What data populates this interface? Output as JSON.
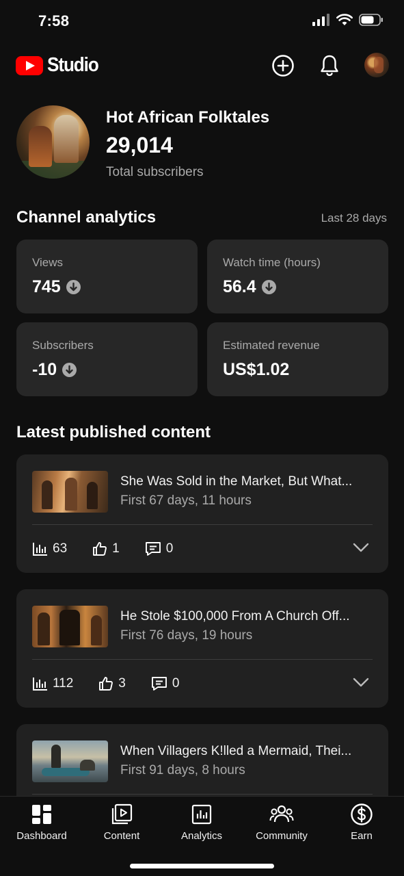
{
  "status_bar": {
    "time": "7:58"
  },
  "header": {
    "brand": "Studio"
  },
  "channel": {
    "name": "Hot African Folktales",
    "subscribers": "29,014",
    "subscribers_label": "Total subscribers"
  },
  "analytics": {
    "title": "Channel analytics",
    "period": "Last 28 days",
    "metrics": [
      {
        "label": "Views",
        "value": "745",
        "trend": "down"
      },
      {
        "label": "Watch time (hours)",
        "value": "56.4",
        "trend": "down"
      },
      {
        "label": "Subscribers",
        "value": "-10",
        "trend": "down"
      },
      {
        "label": "Estimated revenue",
        "value": "US$1.02",
        "trend": "none"
      }
    ]
  },
  "latest": {
    "title": "Latest published content",
    "videos": [
      {
        "title": "She Was Sold in the Market, But What...",
        "period": "First 67 days, 11 hours",
        "views": "63",
        "likes": "1",
        "comments": "0"
      },
      {
        "title": "He Stole $100,000 From A Church Off...",
        "period": "First 76 days, 19 hours",
        "views": "112",
        "likes": "3",
        "comments": "0"
      },
      {
        "title": "When Villagers K!lled a Mermaid, Thei...",
        "period": "First 91 days, 8 hours"
      }
    ]
  },
  "nav": {
    "items": [
      {
        "label": "Dashboard",
        "icon": "dashboard-icon",
        "active": true
      },
      {
        "label": "Content",
        "icon": "content-icon"
      },
      {
        "label": "Analytics",
        "icon": "analytics-icon"
      },
      {
        "label": "Community",
        "icon": "community-icon"
      },
      {
        "label": "Earn",
        "icon": "earn-icon"
      }
    ]
  },
  "colors": {
    "background": "#0f0f0f",
    "card": "#272727",
    "brand_red": "#ff0000",
    "muted_text": "#aaaaaa"
  }
}
